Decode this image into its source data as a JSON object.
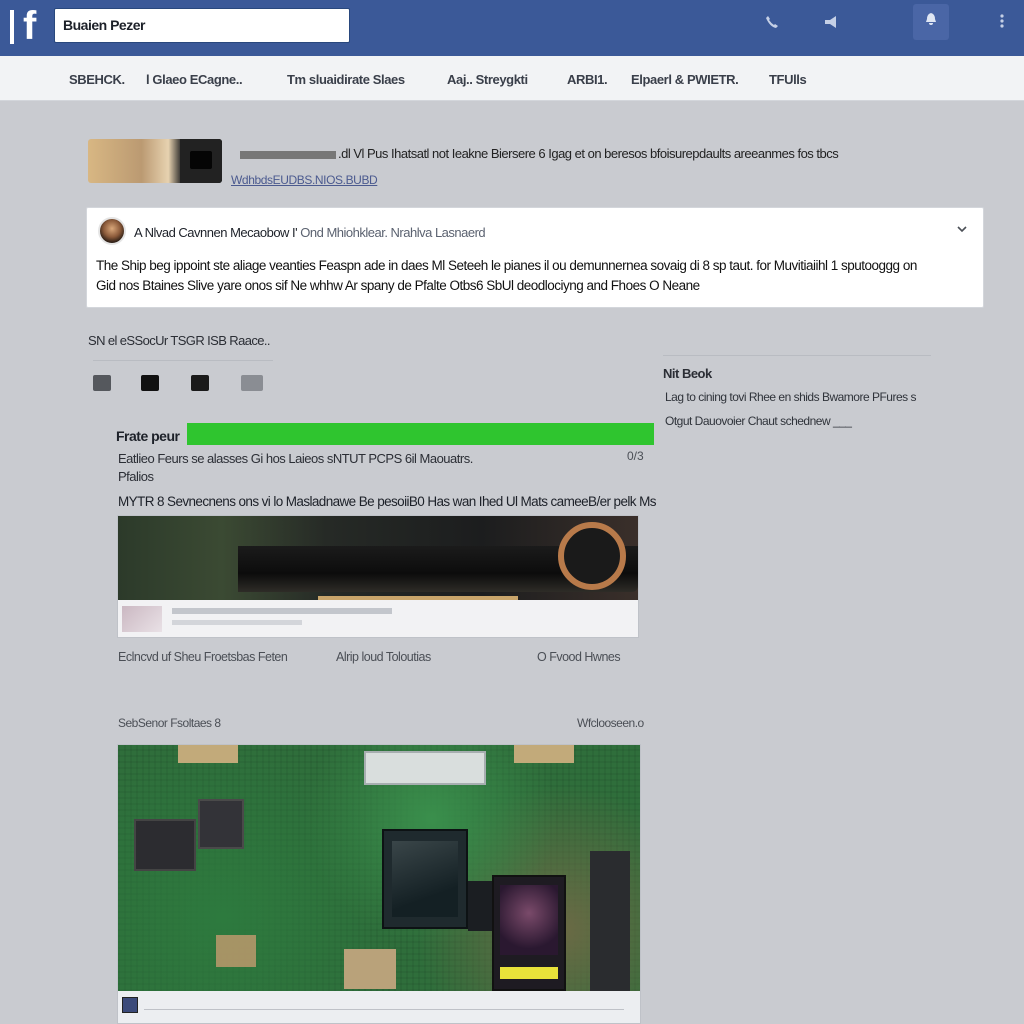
{
  "topbar": {
    "logo": "f",
    "search_value": "Buaien Pezer",
    "icons": [
      "phone-icon",
      "megaphone-icon",
      "notification-icon",
      "more-icon"
    ]
  },
  "subnav": {
    "items": [
      "SBEHCK.",
      "l Glaeo ECagne..",
      "Tm sluaidirate Slaes",
      "Aaj.. Streygkti",
      "ARBI1.",
      "Elpaerl & PWIETR.",
      "TFUlls"
    ]
  },
  "header_post": {
    "text": ".dl Vl Pus Ihatsatl not Ieakne Biersere 6 Igag et on beresos bfoisurepdaults areeanmes fos tbcs",
    "link": "WdhbdsEUDBS.NIOS.BUBD"
  },
  "notice": {
    "title": "A Nlvad Cavnnen Mecaobow I'",
    "title_tail": "Ond Mhiohklear. Nrahlva Lasnaerd",
    "body_line1": "The Ship beg ippoint ste aliage veanties Feaspn ade in daes Ml Seteeh le pianes il ou demunnernea sovaig di 8 sp taut. for Muvitiaiihl 1 sputooggg on",
    "body_line2": "Gid nos Btaines Slive yare onos sif Ne whhw Ar spany de Pfalte Otbs6 SbUl deodlociyng and Fhoes O Neane"
  },
  "section": {
    "title": "SN el eSSocUr TSGR ISB Raace.."
  },
  "sidebar": {
    "title": "Nit Beok",
    "line1": "Lag to cining tovi Rhee en shids Bwamore PFures s",
    "line2": "Otgut Dauovoier Chaut schednew ___"
  },
  "post1": {
    "title": "Frate peur",
    "line1": "Eatlieo Feurs se alasses Gi hos Laieos sNTUT PCPS 6il Maouatrs.",
    "line2": "Pfalios",
    "count": "0/3",
    "line3": "MYTR 8 Sevnecnens ons vi lo Masladnawe Be pesoiiB0 Has wan Ihed Ul Mats cameeB/er pelk Ms",
    "actions": [
      "Eclncvd uf Sheu Froetsbas Feten",
      "Alrip loud Toloutias",
      "O Fvood Hwnes"
    ]
  },
  "post2": {
    "title": "SebSenor Fsoltaes 8",
    "meta": "Wfclooseen.o"
  }
}
